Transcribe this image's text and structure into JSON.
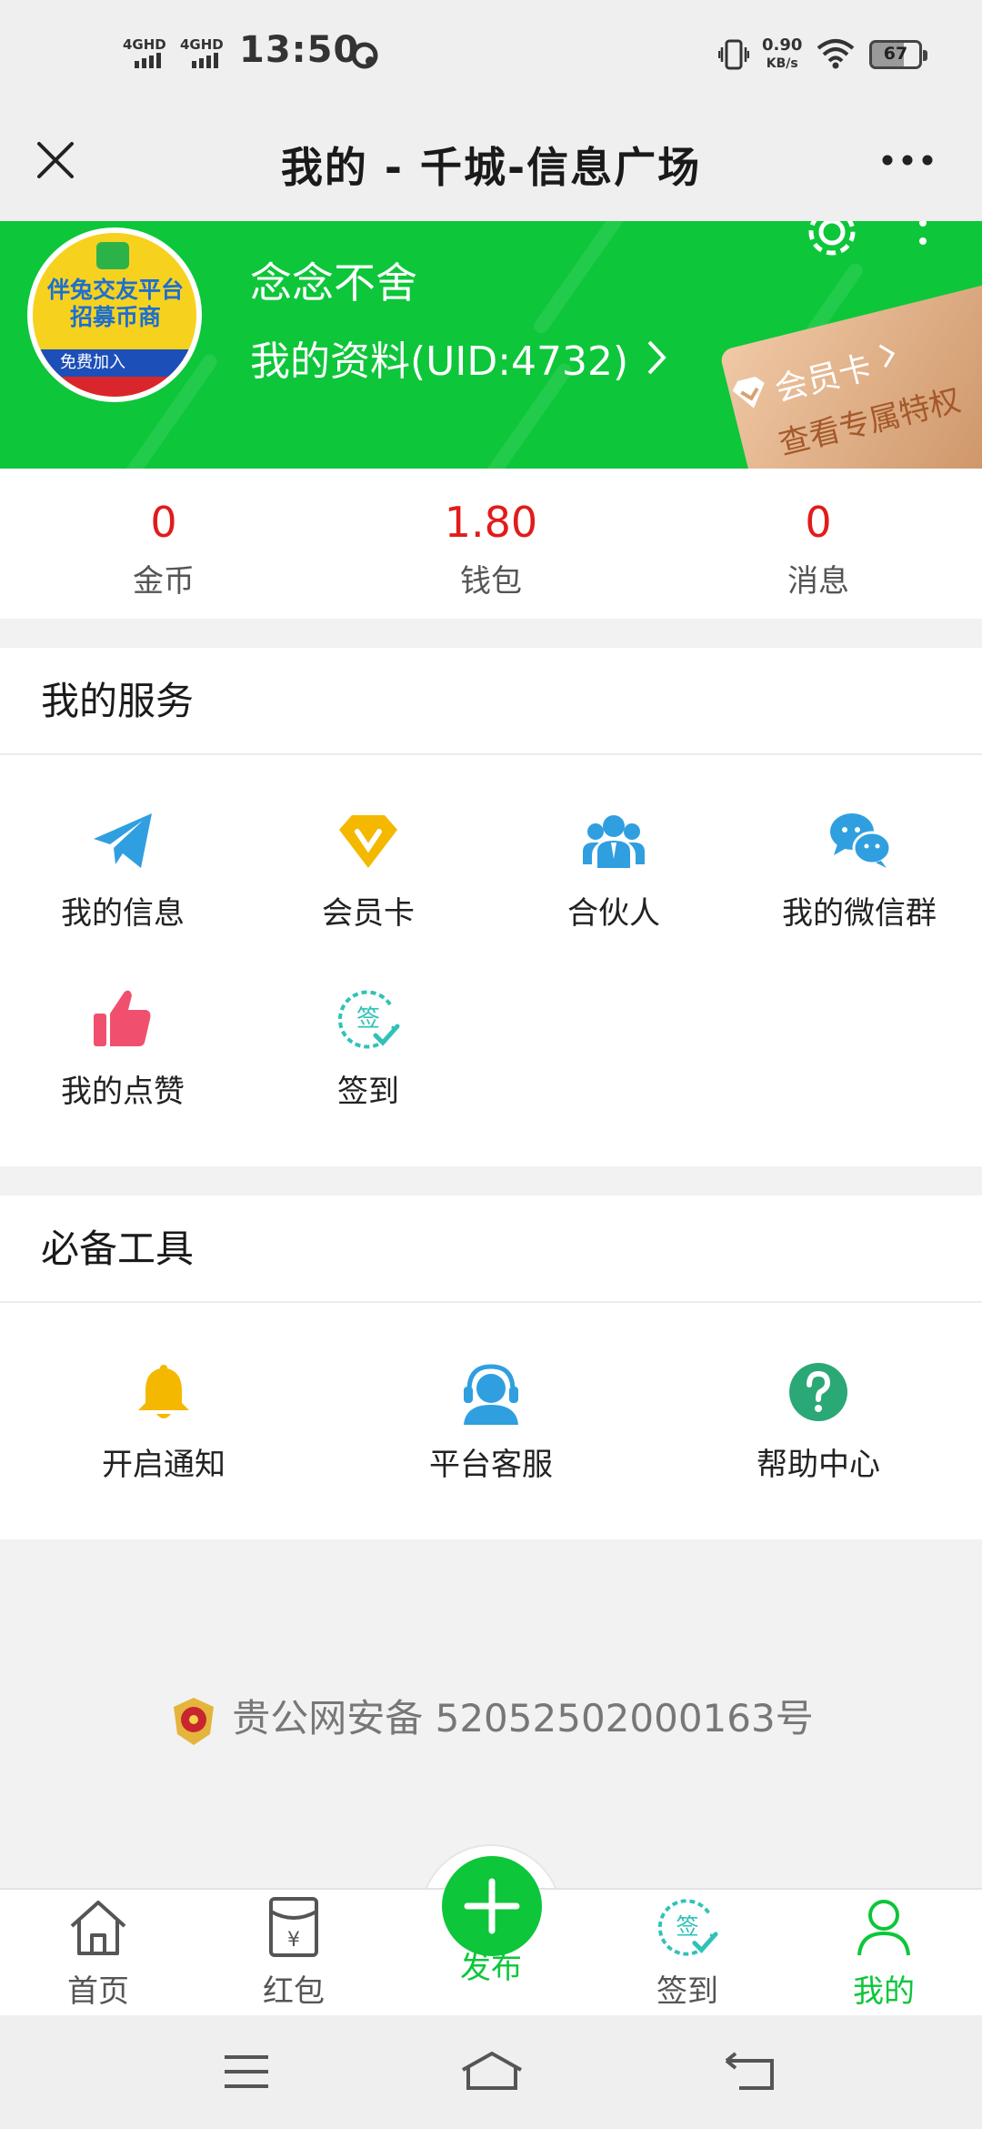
{
  "status_bar": {
    "network_1": "4GHD",
    "network_2": "4GHD",
    "time": "13:50",
    "speed_value": "0.90",
    "speed_unit": "KB/s",
    "battery": "67"
  },
  "nav": {
    "title": "我的 - 千城-信息广场"
  },
  "profile": {
    "avatar_line1": "伴兔交友平台",
    "avatar_line2": "招募币商",
    "avatar_line3": "免费加入",
    "name": "念念不舍",
    "profile_link": "我的资料(UID:4732)",
    "vip_label": "会员卡",
    "vip_sub": "查看专属特权"
  },
  "stats": [
    {
      "value": "0",
      "label": "金币"
    },
    {
      "value": "1.80",
      "label": "钱包"
    },
    {
      "value": "0",
      "label": "消息"
    }
  ],
  "services": {
    "title": "我的服务",
    "items": [
      {
        "label": "我的信息",
        "icon": "paper-plane-icon"
      },
      {
        "label": "会员卡",
        "icon": "vip-diamond-icon"
      },
      {
        "label": "合伙人",
        "icon": "partners-icon"
      },
      {
        "label": "我的微信群",
        "icon": "wechat-icon"
      },
      {
        "label": "我的点赞",
        "icon": "thumbs-up-icon"
      },
      {
        "label": "签到",
        "icon": "sign-in-icon"
      }
    ]
  },
  "tools": {
    "title": "必备工具",
    "items": [
      {
        "label": "开启通知",
        "icon": "bell-icon"
      },
      {
        "label": "平台客服",
        "icon": "customer-service-icon"
      },
      {
        "label": "帮助中心",
        "icon": "help-icon"
      }
    ]
  },
  "footer": {
    "police_record": "贵公网安备 52052502000163号"
  },
  "tabbar": {
    "items": [
      {
        "label": "首页",
        "icon": "home-icon"
      },
      {
        "label": "红包",
        "icon": "red-envelope-icon"
      },
      {
        "label": "发布",
        "icon": "plus-icon"
      },
      {
        "label": "签到",
        "icon": "sign-in-icon"
      },
      {
        "label": "我的",
        "icon": "user-icon"
      }
    ],
    "active": "我的"
  },
  "colors": {
    "brand_green": "#0dc63a",
    "stat_red": "#e21b1b",
    "icon_blue": "#2f9fe0",
    "icon_orange": "#f5b800",
    "icon_pink": "#f0506e",
    "icon_teal": "#2fc2b8"
  }
}
